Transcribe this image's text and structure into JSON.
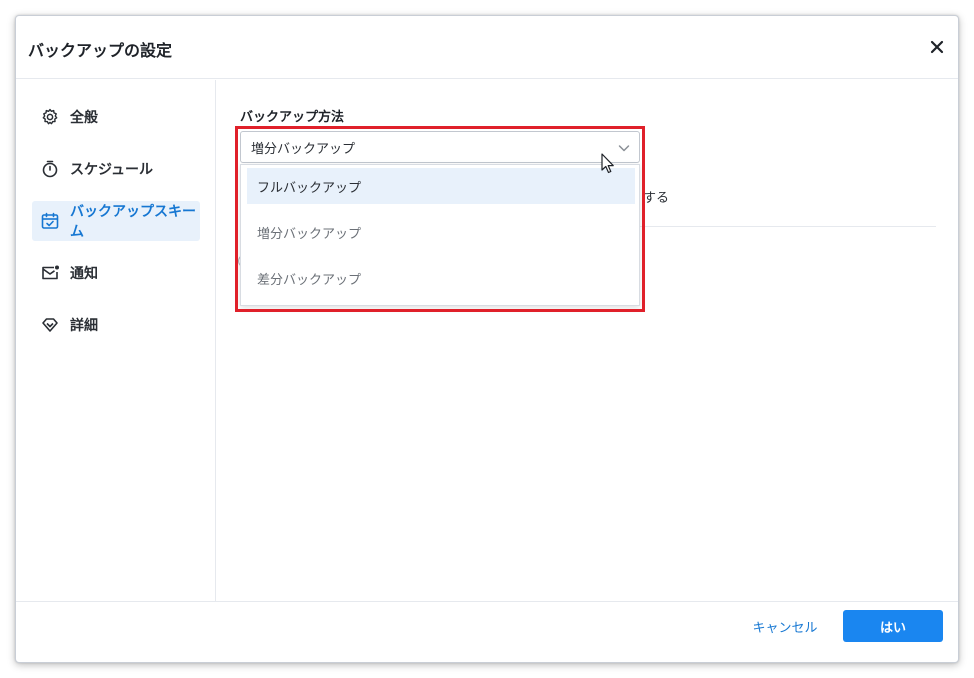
{
  "dialog": {
    "title": "バックアップの設定",
    "close_icon": "close-icon"
  },
  "sidebar": {
    "items": [
      {
        "label": "全般",
        "icon": "gear-icon",
        "active": false
      },
      {
        "label": "スケジュール",
        "icon": "timer-icon",
        "active": false
      },
      {
        "label": "バックアップスキーム",
        "icon": "calendar-check-icon",
        "active": true
      },
      {
        "label": "通知",
        "icon": "mail-icon",
        "active": false
      },
      {
        "label": "詳細",
        "icon": "diamond-icon",
        "active": false
      }
    ]
  },
  "main": {
    "backup_method_label": "バックアップ方法",
    "select": {
      "value": "増分バックアップ",
      "options": [
        "フルバックアップ",
        "増分バックアップ",
        "差分バックアップ"
      ],
      "hovered_option": "フルバックアップ"
    },
    "partial_text_behind": "する"
  },
  "footer": {
    "cancel_label": "キャンセル",
    "ok_label": "はい"
  },
  "colors": {
    "accent": "#1a86f0",
    "active_bg": "#e8f1fb",
    "highlight": "#e0202a"
  }
}
